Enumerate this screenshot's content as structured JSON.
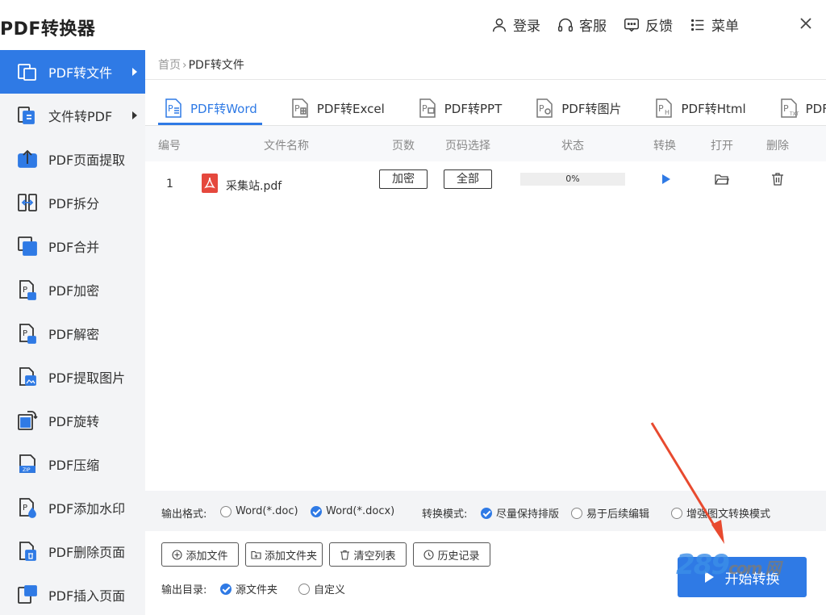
{
  "app": {
    "title": "PDF转换器"
  },
  "toolbar": {
    "login": "登录",
    "service": "客服",
    "feedback": "反馈",
    "menu": "菜单"
  },
  "sidebar": {
    "items": [
      {
        "label": "PDF转文件"
      },
      {
        "label": "文件转PDF"
      },
      {
        "label": "PDF页面提取"
      },
      {
        "label": "PDF拆分"
      },
      {
        "label": "PDF合并"
      },
      {
        "label": "PDF加密"
      },
      {
        "label": "PDF解密"
      },
      {
        "label": "PDF提取图片"
      },
      {
        "label": "PDF旋转"
      },
      {
        "label": "PDF压缩"
      },
      {
        "label": "PDF添加水印"
      },
      {
        "label": "PDF删除页面"
      },
      {
        "label": "PDF插入页面"
      }
    ]
  },
  "breadcrumb": {
    "home": "首页",
    "sep": "›",
    "current": "PDF转文件"
  },
  "tabs": [
    {
      "label": "PDF转Word"
    },
    {
      "label": "PDF转Excel"
    },
    {
      "label": "PDF转PPT"
    },
    {
      "label": "PDF转图片"
    },
    {
      "label": "PDF转Html"
    },
    {
      "label": "PDF转TXT"
    }
  ],
  "table": {
    "columns": [
      "编号",
      "文件名称",
      "页数",
      "页码选择",
      "状态",
      "转换",
      "打开",
      "删除"
    ],
    "rows": [
      {
        "num": "1",
        "name": "采集站.pdf",
        "pages_btn": "加密",
        "range_btn": "全部",
        "status": "0%"
      }
    ]
  },
  "options": {
    "format_label": "输出格式:",
    "format_doc": "Word(*.doc)",
    "format_docx": "Word(*.docx)",
    "mode_label": "转换模式:",
    "mode_keep": "尽量保持排版",
    "mode_edit": "易于后续编辑",
    "mode_enhanced": "增强图文转换模式"
  },
  "actions": {
    "add_file": "添加文件",
    "add_folder": "添加文件夹",
    "clear_list": "清空列表",
    "history": "历史记录"
  },
  "output": {
    "label": "输出目录:",
    "source": "源文件夹",
    "custom": "自定义"
  },
  "start": {
    "label": "开始转换"
  },
  "watermark": {
    "main": "289",
    "sub": "com 网"
  },
  "colors": {
    "accent": "#2f7ae5",
    "sidebar_bg": "#f3f4f6",
    "pdf_red": "#e5483d",
    "arrow": "#e84a2f"
  }
}
